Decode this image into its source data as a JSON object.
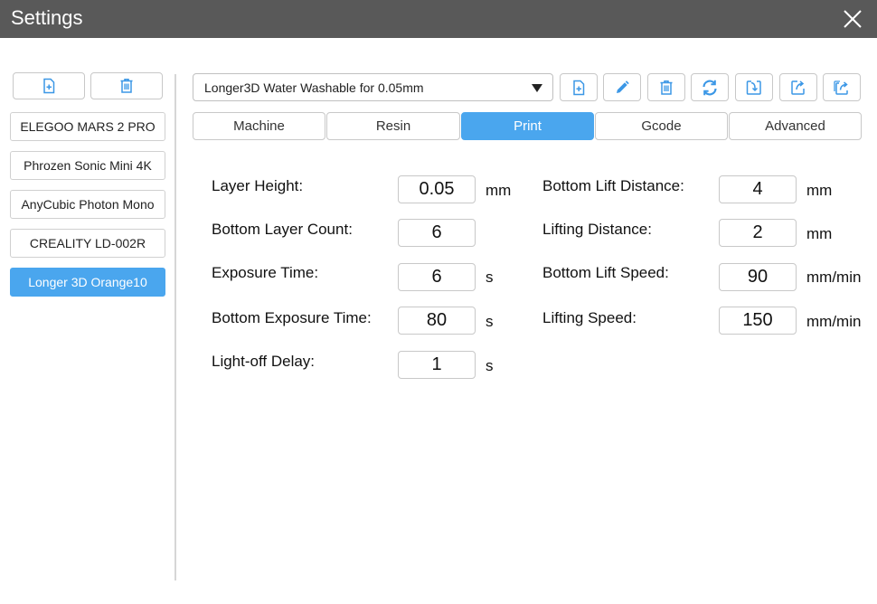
{
  "window": {
    "title": "Settings"
  },
  "printers": {
    "items": [
      {
        "label": "ELEGOO MARS 2 PRO",
        "selected": false
      },
      {
        "label": "Phrozen Sonic Mini 4K",
        "selected": false
      },
      {
        "label": "AnyCubic Photon Mono",
        "selected": false
      },
      {
        "label": "CREALITY LD-002R",
        "selected": false
      },
      {
        "label": "Longer 3D Orange10",
        "selected": true
      }
    ]
  },
  "preset": {
    "selected": "Longer3D Water Washable for 0.05mm"
  },
  "toolbar_icons": [
    "add-file-icon",
    "edit-pencil-icon",
    "trash-icon",
    "refresh-icon",
    "import-icon",
    "export-icon",
    "export-all-icon"
  ],
  "tabs": [
    {
      "label": "Machine",
      "active": false
    },
    {
      "label": "Resin",
      "active": false
    },
    {
      "label": "Print",
      "active": true
    },
    {
      "label": "Gcode",
      "active": false
    },
    {
      "label": "Advanced",
      "active": false
    }
  ],
  "fields_left": [
    {
      "label": "Layer Height:",
      "value": "0.05",
      "unit": "mm"
    },
    {
      "label": "Bottom Layer Count:",
      "value": "6",
      "unit": ""
    },
    {
      "label": "Exposure Time:",
      "value": "6",
      "unit": "s"
    },
    {
      "label": "Bottom Exposure Time:",
      "value": "80",
      "unit": "s"
    },
    {
      "label": "Light-off Delay:",
      "value": "1",
      "unit": "s"
    }
  ],
  "fields_right": [
    {
      "label": "Bottom Lift Distance:",
      "value": "4",
      "unit": "mm"
    },
    {
      "label": "Lifting Distance:",
      "value": "2",
      "unit": "mm"
    },
    {
      "label": "Bottom Lift Speed:",
      "value": "90",
      "unit": "mm/min"
    },
    {
      "label": "Lifting Speed:",
      "value": "150",
      "unit": "mm/min"
    }
  ],
  "colors": {
    "accent": "#4aa6ee",
    "titlebar": "#595959",
    "icon_blue": "#3b97e6"
  }
}
